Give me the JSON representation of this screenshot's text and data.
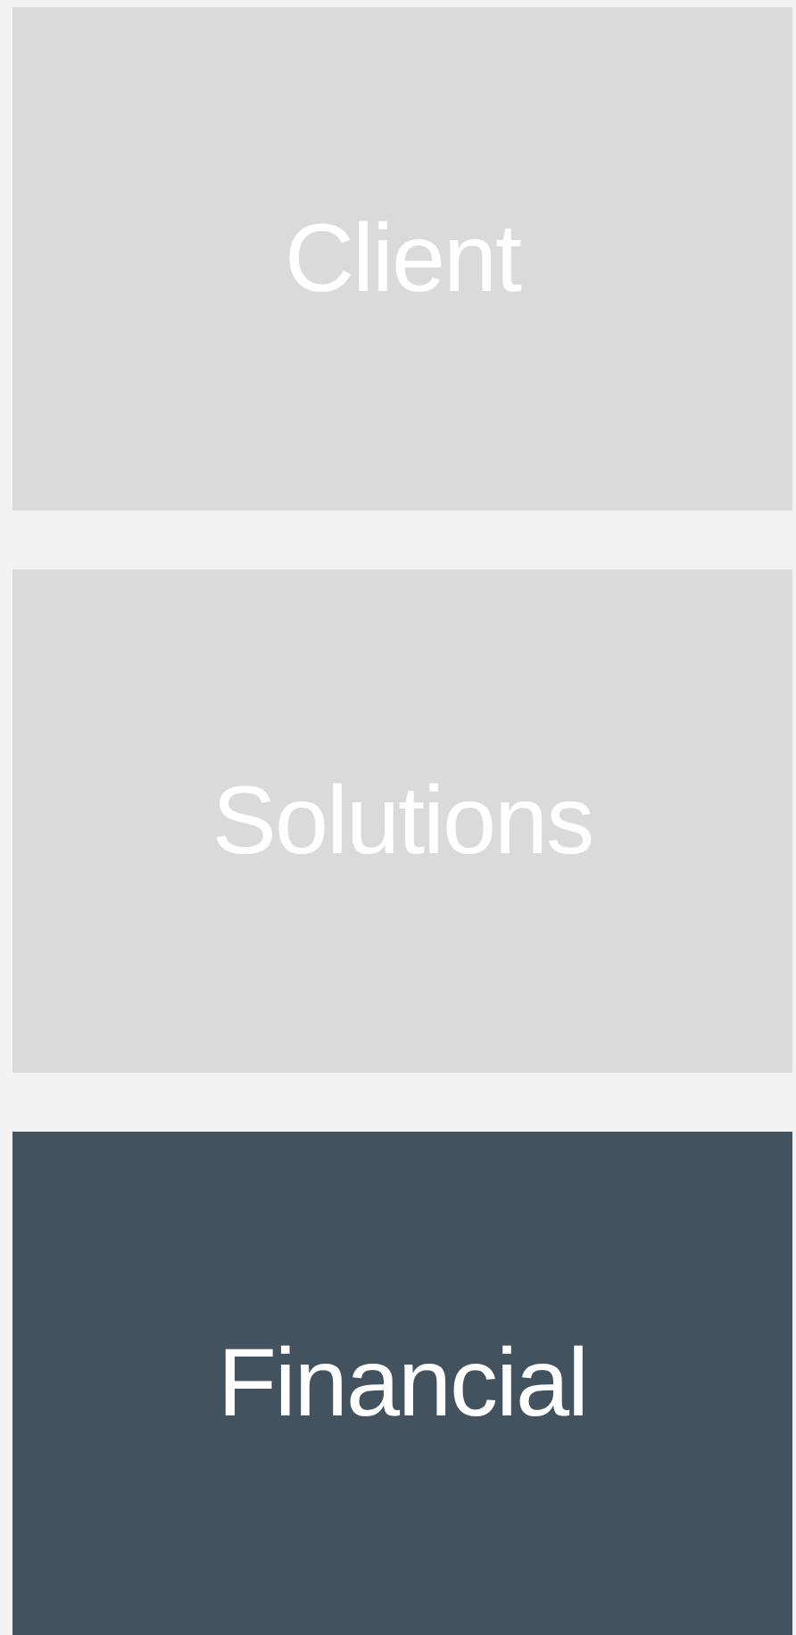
{
  "tiles": [
    {
      "label": "Client",
      "selected": false
    },
    {
      "label": "Solutions",
      "selected": false
    },
    {
      "label": "Financial",
      "selected": true
    }
  ]
}
